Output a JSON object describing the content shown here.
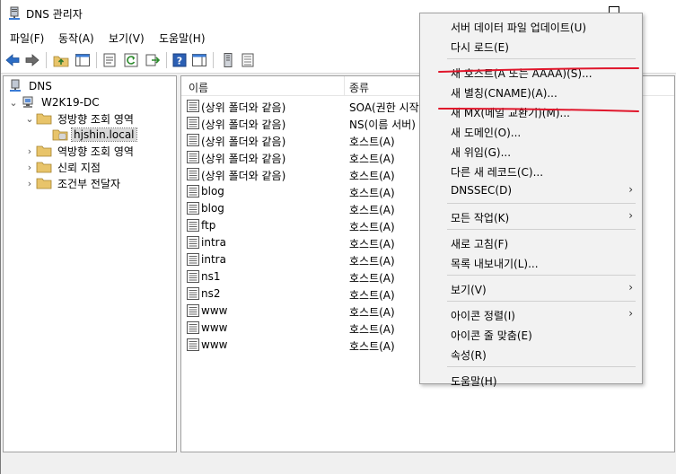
{
  "window": {
    "title": "DNS 관리자"
  },
  "menubar": {
    "items": [
      "파일(F)",
      "동작(A)",
      "보기(V)",
      "도움말(H)"
    ]
  },
  "toolbar": {
    "icons": [
      "back-arrow-icon",
      "forward-arrow-icon",
      "up-folder-icon",
      "show-tree-icon",
      "properties-icon",
      "refresh-icon",
      "export-list-icon",
      "help-icon",
      "show-action-pane-icon",
      "server-icon",
      "zone-records-icon"
    ]
  },
  "tree": {
    "root": "DNS",
    "server": "W2K19-DC",
    "forward_zone": "정방향 조회 영역",
    "zone": "hjshin.local",
    "reverse_zone": "역방향 조회 영역",
    "trust_points": "신뢰 지점",
    "conditional_forwarders": "조건부 전달자"
  },
  "list": {
    "columns": [
      "이름",
      "종류"
    ],
    "rows": [
      {
        "name": "(상위 폴더와 같음)",
        "type": "SOA(권한 시작"
      },
      {
        "name": "(상위 폴더와 같음)",
        "type": "NS(이름 서버)"
      },
      {
        "name": "(상위 폴더와 같음)",
        "type": "호스트(A)"
      },
      {
        "name": "(상위 폴더와 같음)",
        "type": "호스트(A)"
      },
      {
        "name": "(상위 폴더와 같음)",
        "type": "호스트(A)"
      },
      {
        "name": "blog",
        "type": "호스트(A)"
      },
      {
        "name": "blog",
        "type": "호스트(A)"
      },
      {
        "name": "ftp",
        "type": "호스트(A)"
      },
      {
        "name": "intra",
        "type": "호스트(A)"
      },
      {
        "name": "intra",
        "type": "호스트(A)"
      },
      {
        "name": "ns1",
        "type": "호스트(A)"
      },
      {
        "name": "ns2",
        "type": "호스트(A)"
      },
      {
        "name": "www",
        "type": "호스트(A)"
      },
      {
        "name": "www",
        "type": "호스트(A)"
      },
      {
        "name": "www",
        "type": "호스트(A)"
      }
    ]
  },
  "context_menu": {
    "items": [
      {
        "label": "서버 데이터 파일 업데이트(U)",
        "submenu": false
      },
      {
        "label": "다시 로드(E)",
        "submenu": false
      },
      {
        "separator": true
      },
      {
        "label": "새 호스트(A 또는 AAAA)(S)...",
        "submenu": false
      },
      {
        "label": "새 별칭(CNAME)(A)...",
        "submenu": false
      },
      {
        "label": "새 MX(메일 교환기)(M)...",
        "submenu": false
      },
      {
        "label": "새 도메인(O)...",
        "submenu": false
      },
      {
        "label": "새 위임(G)...",
        "submenu": false
      },
      {
        "label": "다른 새 레코드(C)...",
        "submenu": false
      },
      {
        "label": "DNSSEC(D)",
        "submenu": true
      },
      {
        "separator": true
      },
      {
        "label": "모든 작업(K)",
        "submenu": true
      },
      {
        "separator": true
      },
      {
        "label": "새로 고침(F)",
        "submenu": false
      },
      {
        "label": "목록 내보내기(L)...",
        "submenu": false
      },
      {
        "separator": true
      },
      {
        "label": "보기(V)",
        "submenu": true
      },
      {
        "separator": true
      },
      {
        "label": "아이콘 정렬(I)",
        "submenu": true
      },
      {
        "label": "아이콘 줄 맞춤(E)",
        "submenu": false
      },
      {
        "label": "속성(R)",
        "submenu": false
      },
      {
        "separator": true
      },
      {
        "label": "도움말(H)",
        "submenu": false
      }
    ]
  },
  "colors": {
    "annotation": "#e0162b",
    "folder": "#e8c46a",
    "accent": "#2b6cc4"
  }
}
